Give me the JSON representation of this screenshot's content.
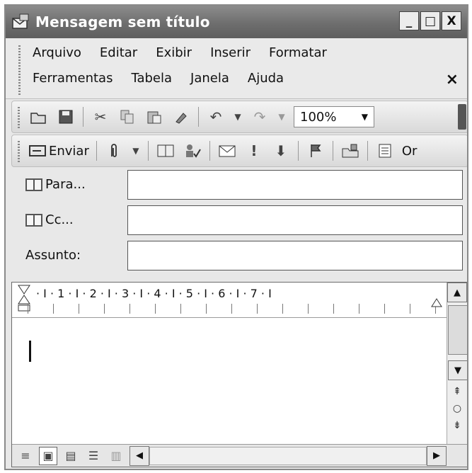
{
  "window": {
    "title": "Mensagem sem título",
    "minimize": "_",
    "maximize": "□",
    "close": "X"
  },
  "menu": {
    "row1": [
      "Arquivo",
      "Editar",
      "Exibir",
      "Inserir",
      "Formatar"
    ],
    "row2": [
      "Ferramentas",
      "Tabela",
      "Janela",
      "Ajuda"
    ],
    "close": "×"
  },
  "standard_toolbar": {
    "zoom": "100%",
    "icons": [
      "open-icon",
      "save-icon",
      "cut-icon",
      "copy-icon",
      "paste-icon",
      "format-painter-icon",
      "undo-icon",
      "redo-icon"
    ]
  },
  "email_toolbar": {
    "send_label": "Enviar",
    "options_label": "Or",
    "icons": [
      "attach-icon",
      "address-book-icon",
      "check-names-icon",
      "envelope-icon",
      "high-importance-icon",
      "low-importance-icon",
      "flag-icon",
      "permission-icon",
      "options-icon"
    ]
  },
  "fields": {
    "to_label": "Para...",
    "cc_label": "Cc...",
    "subject_label": "Assunto:",
    "to_value": "",
    "cc_value": "",
    "subject_value": ""
  },
  "editor": {
    "ruler_numbers": "· I · 1 · I · 2 · I · 3 · I · 4 · I · 5 · I · 6 · I · 7 · I",
    "body": ""
  }
}
